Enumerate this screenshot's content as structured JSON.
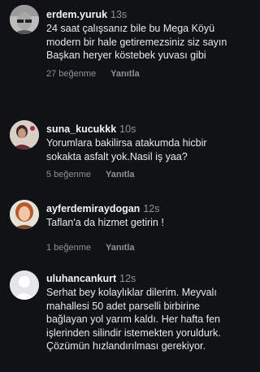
{
  "comments": [
    {
      "username": "erdem.yuruk",
      "time": "13s",
      "text": "24 saat çalışsanız bile bu Mega Köyü modern bir hale getiremezsiniz siz sayın Başkan heryer köstebek yuvası gibi",
      "likes": "27 beğenme",
      "reply": "Yanıtla",
      "avatar_icon": "sunglasses-portrait"
    },
    {
      "username": "suna_kucukkk",
      "time": "10s",
      "text": "Yorumlara bakilirsa atakumda hicbir sokakta asfalt yok.Nasil iş yaa?",
      "likes": "5 beğenme",
      "reply": "Yanıtla",
      "avatar_icon": "portrait-photo"
    },
    {
      "username": "ayferdemiraydogan",
      "time": "12s",
      "text": "Taflan'a da hizmet getirin !",
      "likes": "1 beğenme",
      "reply": "Yanıtla",
      "avatar_icon": "woman-portrait"
    },
    {
      "username": "uluhancankurt",
      "time": "12s",
      "text": "Serhat bey kolaylıklar dilerim. Meyvalı mahallesi 50 adet parselli birbirine bağlayan yol yarım kaldı. Her hafta fen işlerinden silindir istemekten yoruldurk. Çözümün hızlandırılması gerekiyor.",
      "avatar_icon": "default-avatar"
    }
  ]
}
